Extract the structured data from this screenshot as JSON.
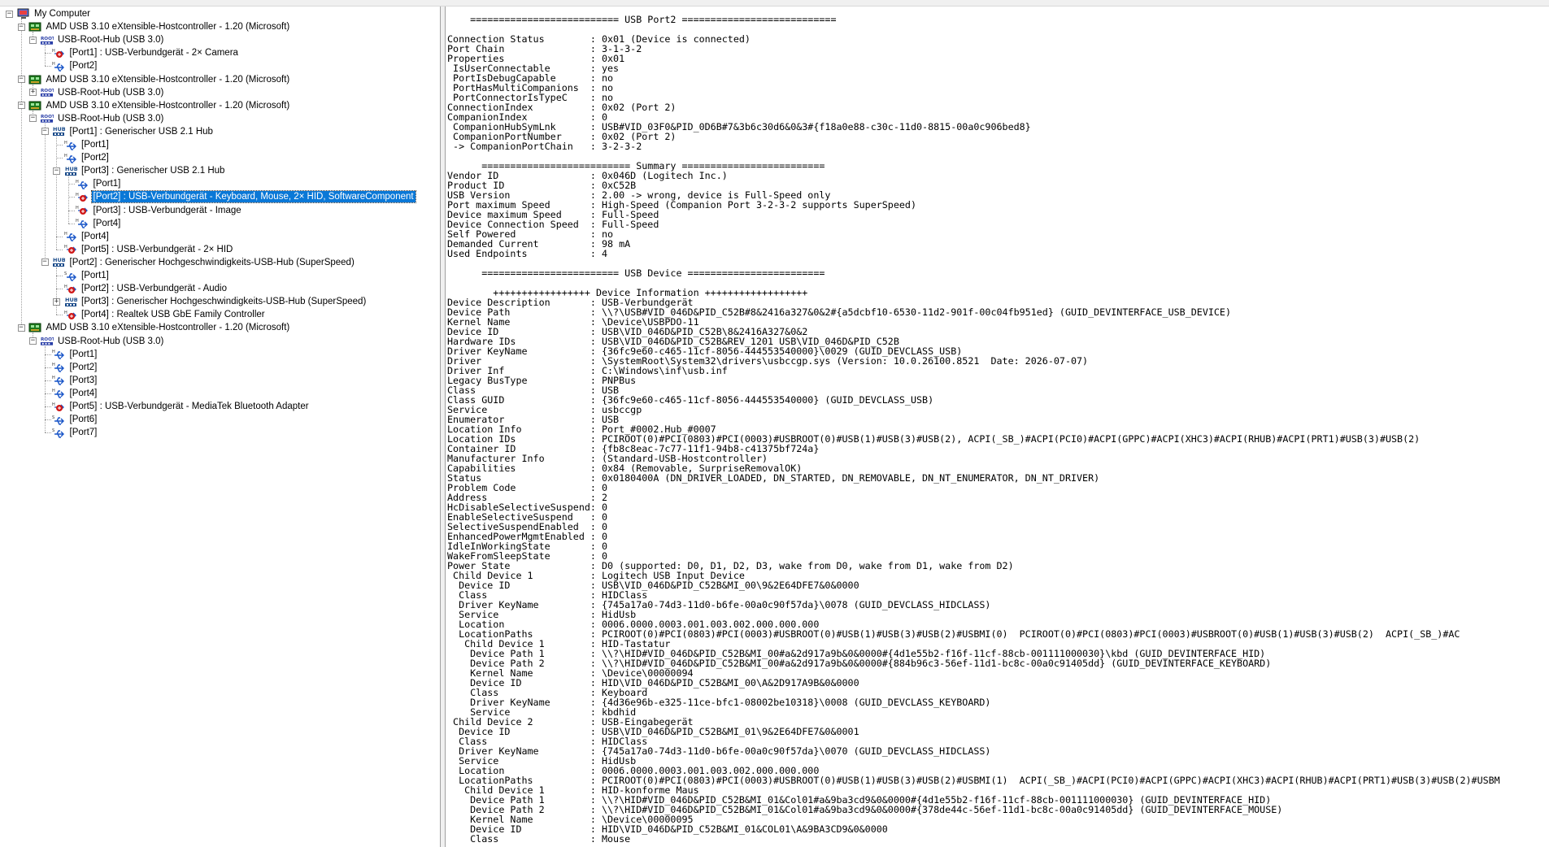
{
  "tree": {
    "nodes": [
      {
        "label": "My Computer",
        "icon": "computer-icon",
        "level": 0,
        "expander": "−",
        "kind": "computer"
      },
      {
        "label": "AMD USB 3.10 eXtensible-Hostcontroller - 1.20 (Microsoft)",
        "icon": "host-controller-icon",
        "level": 1,
        "expander": "−",
        "kind": "controller"
      },
      {
        "label": "USB-Root-Hub (USB 3.0)",
        "icon": "root-hub-icon",
        "level": 2,
        "expander": "−",
        "kind": "root"
      },
      {
        "label": "[Port1] : USB-Verbundgerät - 2× Camera",
        "icon": "usb-device-icon",
        "level": 3,
        "expander": "",
        "kind": "device"
      },
      {
        "label": "[Port2]",
        "icon": "usb-port-icon",
        "level": 3,
        "expander": "",
        "kind": "port"
      },
      {
        "label": "AMD USB 3.10 eXtensible-Hostcontroller - 1.20 (Microsoft)",
        "icon": "host-controller-icon",
        "level": 1,
        "expander": "−",
        "kind": "controller"
      },
      {
        "label": "USB-Root-Hub (USB 3.0)",
        "icon": "root-hub-icon",
        "level": 2,
        "expander": "+",
        "kind": "root"
      },
      {
        "label": "AMD USB 3.10 eXtensible-Hostcontroller - 1.20 (Microsoft)",
        "icon": "host-controller-icon",
        "level": 1,
        "expander": "−",
        "kind": "controller"
      },
      {
        "label": "USB-Root-Hub (USB 3.0)",
        "icon": "root-hub-icon",
        "level": 2,
        "expander": "−",
        "kind": "root"
      },
      {
        "label": "[Port1] : Generischer USB 2.1 Hub",
        "icon": "hub-icon",
        "level": 3,
        "expander": "−",
        "kind": "hub"
      },
      {
        "label": "[Port1]",
        "icon": "usb-port-icon",
        "level": 4,
        "expander": "",
        "kind": "port"
      },
      {
        "label": "[Port2]",
        "icon": "usb-port-icon",
        "level": 4,
        "expander": "",
        "kind": "port"
      },
      {
        "label": "[Port3] : Generischer USB 2.1 Hub",
        "icon": "hub-icon",
        "level": 4,
        "expander": "−",
        "kind": "hub"
      },
      {
        "label": "[Port1]",
        "icon": "usb-port-icon",
        "level": 5,
        "expander": "",
        "kind": "port"
      },
      {
        "label": "[Port2] : USB-Verbundgerät - Keyboard, Mouse, 2× HID, SoftwareComponent",
        "icon": "usb-device-icon",
        "level": 5,
        "expander": "",
        "kind": "device",
        "selected": true
      },
      {
        "label": "[Port3] : USB-Verbundgerät - Image",
        "icon": "usb-device-icon",
        "level": 5,
        "expander": "",
        "kind": "device"
      },
      {
        "label": "[Port4]",
        "icon": "usb-port-icon",
        "level": 5,
        "expander": "",
        "kind": "port"
      },
      {
        "label": "[Port4]",
        "icon": "usb-port-icon",
        "level": 4,
        "expander": "",
        "kind": "port"
      },
      {
        "label": "[Port5] : USB-Verbundgerät - 2× HID",
        "icon": "usb-device-icon",
        "level": 4,
        "expander": "",
        "kind": "device"
      },
      {
        "label": "[Port2] : Generischer Hochgeschwindigkeits-USB-Hub (SuperSpeed)",
        "icon": "hub-icon",
        "level": 3,
        "expander": "−",
        "kind": "hub"
      },
      {
        "label": "[Port1]",
        "icon": "usb-port-ss-icon",
        "level": 4,
        "expander": "",
        "kind": "port"
      },
      {
        "label": "[Port2] : USB-Verbundgerät - Audio",
        "icon": "usb-device-icon",
        "level": 4,
        "expander": "",
        "kind": "device"
      },
      {
        "label": "[Port3] : Generischer Hochgeschwindigkeits-USB-Hub (SuperSpeed)",
        "icon": "hub-icon",
        "level": 4,
        "expander": "+",
        "kind": "hub"
      },
      {
        "label": "[Port4] : Realtek USB GbE Family Controller",
        "icon": "usb-device-icon",
        "level": 4,
        "expander": "",
        "kind": "device"
      },
      {
        "label": "AMD USB 3.10 eXtensible-Hostcontroller - 1.20 (Microsoft)",
        "icon": "host-controller-icon",
        "level": 1,
        "expander": "−",
        "kind": "controller"
      },
      {
        "label": "USB-Root-Hub (USB 3.0)",
        "icon": "root-hub-icon",
        "level": 2,
        "expander": "−",
        "kind": "root"
      },
      {
        "label": "[Port1]",
        "icon": "usb-port-icon",
        "level": 3,
        "expander": "",
        "kind": "port"
      },
      {
        "label": "[Port2]",
        "icon": "usb-port-icon",
        "level": 3,
        "expander": "",
        "kind": "port"
      },
      {
        "label": "[Port3]",
        "icon": "usb-port-icon",
        "level": 3,
        "expander": "",
        "kind": "port"
      },
      {
        "label": "[Port4]",
        "icon": "usb-port-icon",
        "level": 3,
        "expander": "",
        "kind": "port"
      },
      {
        "label": "[Port5] : USB-Verbundgerät - MediaTek Bluetooth Adapter",
        "icon": "usb-device-icon",
        "level": 3,
        "expander": "",
        "kind": "device"
      },
      {
        "label": "[Port6]",
        "icon": "usb-port-ss-icon",
        "level": 3,
        "expander": "",
        "kind": "port"
      },
      {
        "label": "[Port7]",
        "icon": "usb-port-ss-icon",
        "level": 3,
        "expander": "",
        "kind": "port"
      }
    ]
  },
  "details": {
    "lines": [
      "    ========================== USB Port2 ===========================",
      "",
      "Connection Status        : 0x01 (Device is connected)",
      "Port Chain               : 3-1-3-2",
      "Properties               : 0x01",
      " IsUserConnectable       : yes",
      " PortIsDebugCapable      : no",
      " PortHasMultiCompanions  : no",
      " PortConnectorIsTypeC    : no",
      "ConnectionIndex          : 0x02 (Port 2)",
      "CompanionIndex           : 0",
      " CompanionHubSymLnk      : USB#VID_03F0&PID_0D6B#7&3b6c30d6&0&3#{f18a0e88-c30c-11d0-8815-00a0c906bed8}",
      " CompanionPortNumber     : 0x02 (Port 2)",
      " -> CompanionPortChain   : 3-2-3-2",
      "",
      "      ========================== Summary =========================",
      "Vendor ID                : 0x046D (Logitech Inc.)",
      "Product ID               : 0xC52B",
      "USB Version              : 2.00 -> wrong, device is Full-Speed only",
      "Port maximum Speed       : High-Speed (Companion Port 3-2-3-2 supports SuperSpeed)",
      "Device maximum Speed     : Full-Speed",
      "Device Connection Speed  : Full-Speed",
      "Self Powered             : no",
      "Demanded Current         : 98 mA",
      "Used Endpoints           : 4",
      "",
      "      ======================== USB Device ========================",
      "",
      "        +++++++++++++++++ Device Information ++++++++++++++++++",
      "Device Description       : USB-Verbundgerät",
      "Device Path              : \\\\?\\USB#VID_046D&PID_C52B#8&2416a327&0&2#{a5dcbf10-6530-11d2-901f-00c04fb951ed} (GUID_DEVINTERFACE_USB_DEVICE)",
      "Kernel Name              : \\Device\\USBPDO-11",
      "Device ID                : USB\\VID_046D&PID_C52B\\8&2416A327&0&2",
      "Hardware IDs             : USB\\VID_046D&PID_C52B&REV_1201 USB\\VID_046D&PID_C52B",
      "Driver KeyName           : {36fc9e60-c465-11cf-8056-444553540000}\\0029 (GUID_DEVCLASS_USB)",
      "Driver                   : \\SystemRoot\\System32\\drivers\\usbccgp.sys (Version: 10.0.26100.8521  Date: 2026-07-07)",
      "Driver Inf               : C:\\Windows\\inf\\usb.inf",
      "Legacy BusType           : PNPBus",
      "Class                    : USB",
      "Class GUID               : {36fc9e60-c465-11cf-8056-444553540000} (GUID_DEVCLASS_USB)",
      "Service                  : usbccgp",
      "Enumerator               : USB",
      "Location Info            : Port_#0002.Hub_#0007",
      "Location IDs             : PCIROOT(0)#PCI(0803)#PCI(0003)#USBROOT(0)#USB(1)#USB(3)#USB(2), ACPI(_SB_)#ACPI(PCI0)#ACPI(GPPC)#ACPI(XHC3)#ACPI(RHUB)#ACPI(PRT1)#USB(3)#USB(2)",
      "Container ID             : {fb8c8eac-7c77-11f1-94b8-c41375bf724a}",
      "Manufacturer Info        : (Standard-USB-Hostcontroller)",
      "Capabilities             : 0x84 (Removable, SurpriseRemovalOK)",
      "Status                   : 0x0180400A (DN_DRIVER_LOADED, DN_STARTED, DN_REMOVABLE, DN_NT_ENUMERATOR, DN_NT_DRIVER)",
      "Problem Code             : 0",
      "Address                  : 2",
      "HcDisableSelectiveSuspend: 0",
      "EnableSelectiveSuspend   : 0",
      "SelectiveSuspendEnabled  : 0",
      "EnhancedPowerMgmtEnabled : 0",
      "IdleInWorkingState       : 0",
      "WakeFromSleepState       : 0",
      "Power State              : D0 (supported: D0, D1, D2, D3, wake from D0, wake from D1, wake from D2)",
      " Child Device 1          : Logitech USB Input Device",
      "  Device ID              : USB\\VID_046D&PID_C52B&MI_00\\9&2E64DFE7&0&0000",
      "  Class                  : HIDClass",
      "  Driver KeyName         : {745a17a0-74d3-11d0-b6fe-00a0c90f57da}\\0078 (GUID_DEVCLASS_HIDCLASS)",
      "  Service                : HidUsb",
      "  Location               : 0006.0000.0003.001.003.002.000.000.000",
      "  LocationPaths          : PCIROOT(0)#PCI(0803)#PCI(0003)#USBROOT(0)#USB(1)#USB(3)#USB(2)#USBMI(0)  PCIROOT(0)#PCI(0803)#PCI(0003)#USBROOT(0)#USB(1)#USB(3)#USB(2)  ACPI(_SB_)#AC",
      "   Child Device 1        : HID-Tastatur",
      "    Device Path 1        : \\\\?\\HID#VID_046D&PID_C52B&MI_00#a&2d917a9b&0&0000#{4d1e55b2-f16f-11cf-88cb-001111000030}\\kbd (GUID_DEVINTERFACE_HID)",
      "    Device Path 2        : \\\\?\\HID#VID_046D&PID_C52B&MI_00#a&2d917a9b&0&0000#{884b96c3-56ef-11d1-bc8c-00a0c91405dd} (GUID_DEVINTERFACE_KEYBOARD)",
      "    Kernel Name          : \\Device\\00000094",
      "    Device ID            : HID\\VID_046D&PID_C52B&MI_00\\A&2D917A9B&0&0000",
      "    Class                : Keyboard",
      "    Driver KeyName       : {4d36e96b-e325-11ce-bfc1-08002be10318}\\0008 (GUID_DEVCLASS_KEYBOARD)",
      "    Service              : kbdhid",
      " Child Device 2          : USB-Eingabegerät",
      "  Device ID              : USB\\VID_046D&PID_C52B&MI_01\\9&2E64DFE7&0&0001",
      "  Class                  : HIDClass",
      "  Driver KeyName         : {745a17a0-74d3-11d0-b6fe-00a0c90f57da}\\0070 (GUID_DEVCLASS_HIDCLASS)",
      "  Service                : HidUsb",
      "  Location               : 0006.0000.0003.001.003.002.000.000.000",
      "  LocationPaths          : PCIROOT(0)#PCI(0803)#PCI(0003)#USBROOT(0)#USB(1)#USB(3)#USB(2)#USBMI(1)  ACPI(_SB_)#ACPI(PCI0)#ACPI(GPPC)#ACPI(XHC3)#ACPI(RHUB)#ACPI(PRT1)#USB(3)#USB(2)#USBM",
      "   Child Device 1        : HID-konforme Maus",
      "    Device Path 1        : \\\\?\\HID#VID_046D&PID_C52B&MI_01&Col01#a&9ba3cd9&0&0000#{4d1e55b2-f16f-11cf-88cb-001111000030} (GUID_DEVINTERFACE_HID)",
      "    Device Path 2        : \\\\?\\HID#VID_046D&PID_C52B&MI_01&Col01#a&9ba3cd9&0&0000#{378de44c-56ef-11d1-bc8c-00a0c91405dd} (GUID_DEVINTERFACE_MOUSE)",
      "    Kernel Name          : \\Device\\00000095",
      "    Device ID            : HID\\VID_046D&PID_C52B&MI_01&COL01\\A&9BA3CD9&0&0000",
      "    Class                : Mouse"
    ]
  },
  "colors": {
    "selection": "#0a78d7",
    "port_blue": "#1a56c8",
    "device_red": "#d01818",
    "controller_green": "#1e7a1e",
    "root_blue": "#2a3fa8"
  }
}
